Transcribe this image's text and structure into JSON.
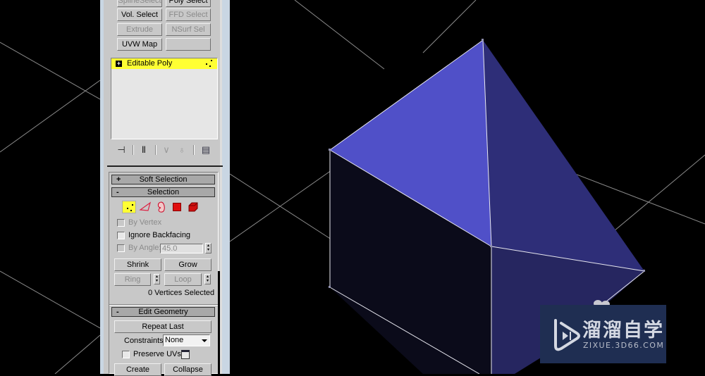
{
  "modifier_buttons": [
    {
      "label": "SplineSelect",
      "enabled": false
    },
    {
      "label": "Poly Select",
      "enabled": true
    },
    {
      "label": "Vol. Select",
      "enabled": true
    },
    {
      "label": "FFD Select",
      "enabled": false
    },
    {
      "label": "Extrude",
      "enabled": false
    },
    {
      "label": "NSurf Sel",
      "enabled": false
    },
    {
      "label": "UVW Map",
      "enabled": true
    },
    {
      "label": "",
      "enabled": false
    }
  ],
  "modifier_stack": {
    "items": [
      {
        "label": "Editable Poly",
        "expand_icon": "+",
        "selected": true,
        "highlight_color": "#ffff33"
      }
    ]
  },
  "stack_tools": [
    {
      "icon": "pin-stack-icon",
      "glyph": "⊣"
    },
    {
      "icon": "show-end-result-icon",
      "glyph": "Ⅱ"
    },
    {
      "icon": "make-unique-icon",
      "glyph": "∨"
    },
    {
      "icon": "remove-modifier-icon",
      "glyph": "♁"
    },
    {
      "icon": "configure-modifier-sets-icon",
      "glyph": "▤"
    }
  ],
  "rollouts": {
    "soft_selection": {
      "title": "Soft Selection",
      "sign": "+"
    },
    "selection": {
      "title": "Selection",
      "sign": "-",
      "subobject_levels": [
        {
          "name": "vertex",
          "active": true
        },
        {
          "name": "edge",
          "active": false
        },
        {
          "name": "border",
          "active": false
        },
        {
          "name": "polygon",
          "active": false
        },
        {
          "name": "element",
          "active": false
        }
      ],
      "by_vertex": {
        "label": "By Vertex",
        "checked": false,
        "enabled": false
      },
      "ignore_backfacing": {
        "label": "Ignore Backfacing",
        "checked": false,
        "enabled": true
      },
      "by_angle": {
        "label": "By Angle:",
        "checked": false,
        "enabled": false,
        "value": "45.0"
      },
      "shrink_label": "Shrink",
      "grow_label": "Grow",
      "ring_label": "Ring",
      "loop_label": "Loop",
      "status": "0 Vertices Selected"
    },
    "edit_geometry": {
      "title": "Edit Geometry",
      "sign": "-",
      "repeat_last_label": "Repeat Last",
      "constraints_label": "Constraints:",
      "constraints_value": "None",
      "preserve_uvs_label": "Preserve UVs",
      "preserve_uvs_checked": false,
      "create_label": "Create",
      "collapse_label": "Collapse"
    }
  },
  "viewport": {
    "background": "#000000",
    "object_colors": {
      "top_left_face": "#5050c8",
      "top_right_face": "#2e2e78",
      "front_face": "#0b0b1a",
      "right_face": "#262660",
      "edges": "#e8e8f0",
      "grid": "#8a8a8a"
    }
  },
  "watermark": {
    "title": "溜溜自学",
    "subtitle": "ZIXUE.3D66.COM"
  }
}
